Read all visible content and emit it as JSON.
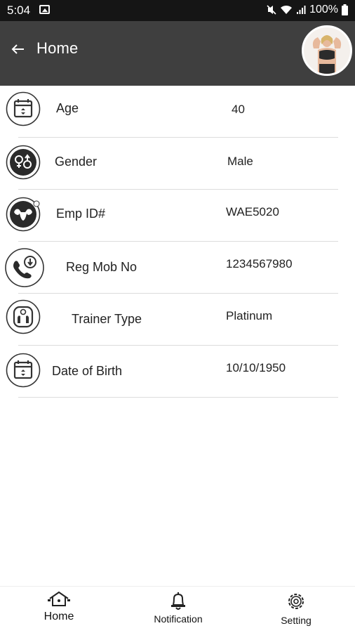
{
  "status_bar": {
    "time": "5:04",
    "battery": "100%"
  },
  "app_bar": {
    "title": "Home",
    "back_icon": "arrow-left-icon"
  },
  "rows": [
    {
      "label": "Age",
      "value": "40",
      "icon": "calendar-icon"
    },
    {
      "label": "Gender",
      "value": "Male",
      "icon": "gender-icon"
    },
    {
      "label": "Emp ID#",
      "value": "WAE5020",
      "icon": "muscle-icon"
    },
    {
      "label": "Reg Mob No",
      "value": "1234567980",
      "icon": "phone-icon"
    },
    {
      "label": "Trainer Type",
      "value": "Platinum",
      "icon": "scale-icon"
    },
    {
      "label": "Date of Birth",
      "value": "10/10/1950",
      "icon": "calendar-icon"
    }
  ],
  "bottom_nav": [
    {
      "label": "Home",
      "icon": "home-icon",
      "active": true
    },
    {
      "label": "Notification",
      "icon": "bell-icon",
      "active": false
    },
    {
      "label": "Setting",
      "icon": "gear-icon",
      "active": false
    }
  ],
  "colors": {
    "app_bar": "#3f3f3f",
    "status_bar": "#151515",
    "divider": "#dcdcdc"
  }
}
